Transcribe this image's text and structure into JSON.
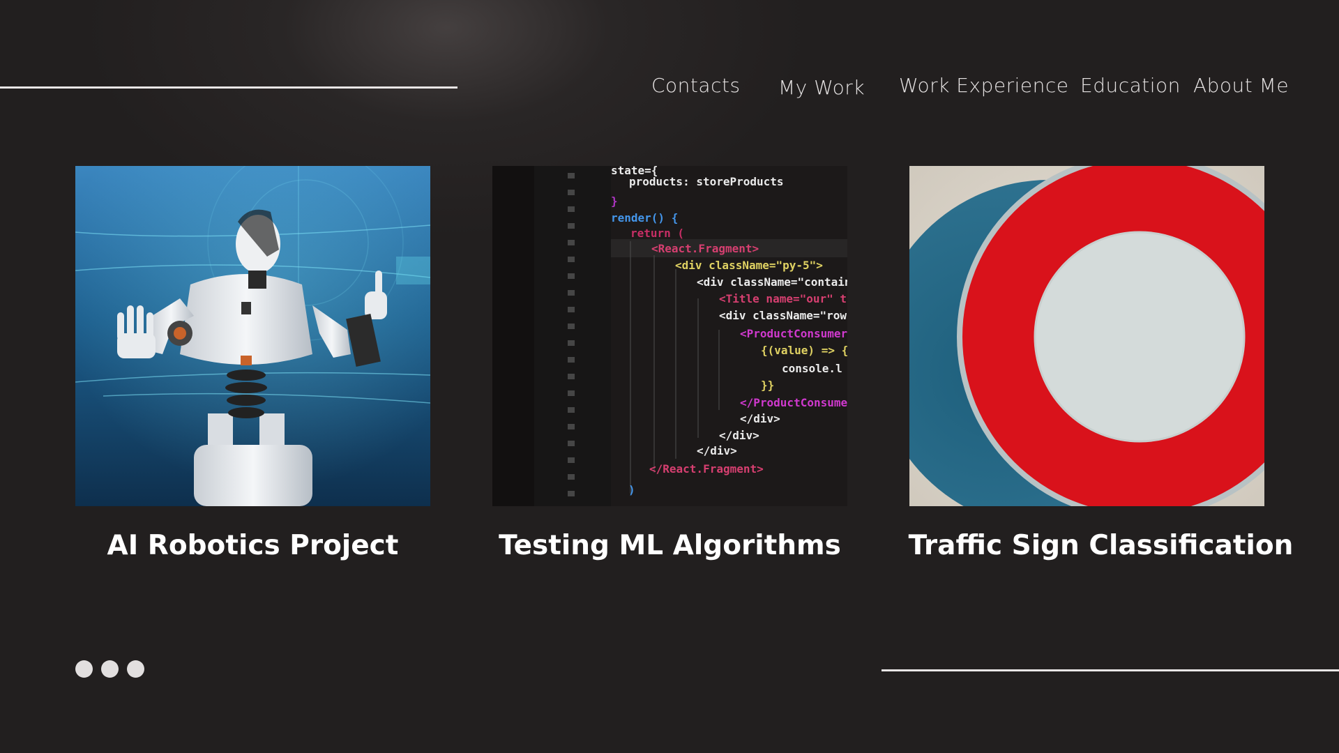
{
  "nav": {
    "items": [
      {
        "label": "Contacts"
      },
      {
        "label": "My Work"
      },
      {
        "label": "Work Experience"
      },
      {
        "label": "Education"
      },
      {
        "label": "About Me"
      }
    ]
  },
  "projects": [
    {
      "title": "AI Robotics Project",
      "image": "robot-photo"
    },
    {
      "title": "Testing ML Algorithms",
      "image": "code-screen-photo"
    },
    {
      "title": "Traffic Sign Classification",
      "image": "traffic-sign-photo"
    }
  ],
  "code_snippet": {
    "lines": [
      "state={",
      "products: storeProducts",
      "}",
      "render() {",
      "return (",
      "<React.Fragment>",
      "<div className=\"py-5\">",
      "<div className=\"container",
      "<Title name=\"our\" tit",
      "<div className=\"row\">",
      "<ProductConsumer>",
      "{(value) => {",
      "console.l",
      "}}",
      "</ProductConsumer",
      "</div>",
      "</div>",
      "</div>",
      "</React.Fragment>",
      ")"
    ]
  },
  "colors": {
    "background": "#221f1f",
    "text": "#ffffff",
    "rule": "#e9e6e6",
    "sign_red": "#d9121b"
  }
}
